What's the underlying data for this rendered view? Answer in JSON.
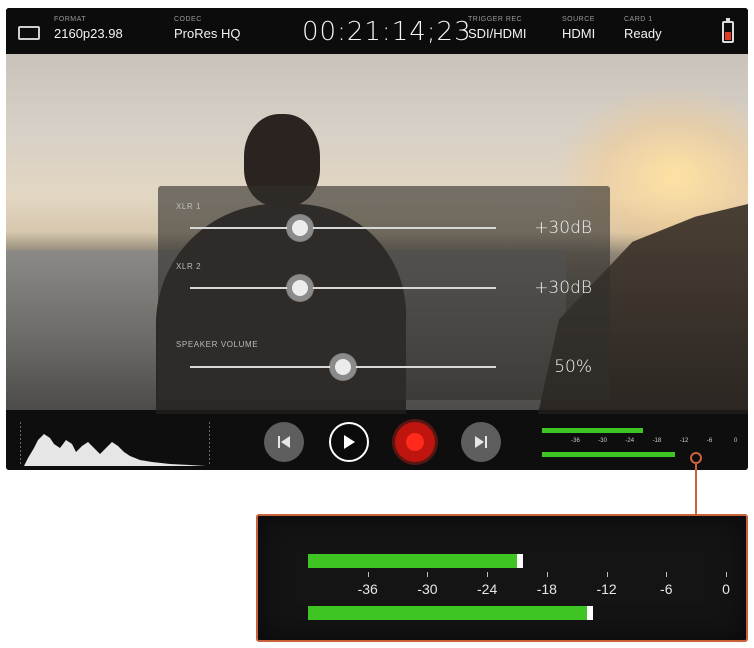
{
  "status_bar": {
    "format": {
      "label": "FORMAT",
      "value": "2160p23.98"
    },
    "codec": {
      "label": "CODEC",
      "value": "ProRes HQ"
    },
    "timecode": "00:21:14;23",
    "trigger_rec": {
      "label": "TRIGGER REC",
      "value": "SDI/HDMI"
    },
    "source": {
      "label": "SOURCE",
      "value": "HDMI"
    },
    "card": {
      "label": "CARD 1",
      "value": "Ready"
    },
    "battery_color": "#e03a2a"
  },
  "audio_panel": {
    "channels": [
      {
        "label": "XLR 1",
        "value": "+30dB",
        "level": 0.36
      },
      {
        "label": "XLR 2",
        "value": "+30dB",
        "level": 0.36
      },
      {
        "label": "SPEAKER VOLUME",
        "value": "50%",
        "level": 0.5
      }
    ]
  },
  "transport": {
    "buttons": [
      {
        "name": "skip-back-button",
        "icon": "skip-back-icon"
      },
      {
        "name": "play-button",
        "icon": "play-icon"
      },
      {
        "name": "record-button",
        "icon": "record-icon"
      },
      {
        "name": "skip-forward-button",
        "icon": "skip-forward-icon"
      }
    ],
    "record_color": "#c0150f"
  },
  "audio_meter": {
    "scale": [
      "-36",
      "-30",
      "-24",
      "-18",
      "-12",
      "-6",
      "0"
    ],
    "channel_levels_db": [
      -21,
      -14
    ],
    "meter_color": "#3fc523",
    "callout_color": "#c9623a"
  }
}
